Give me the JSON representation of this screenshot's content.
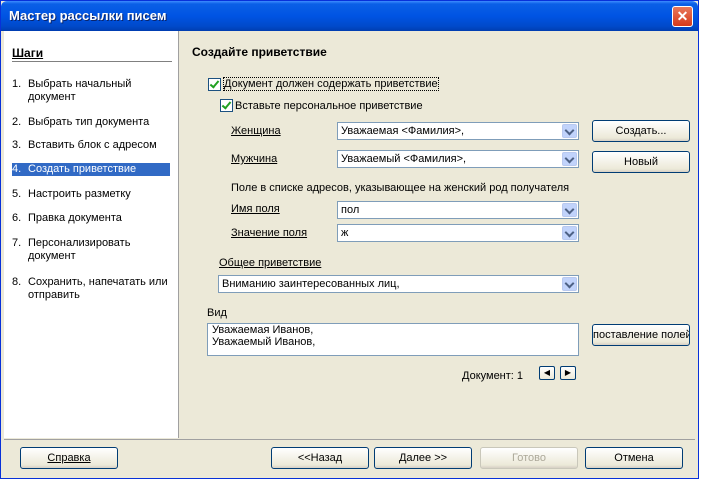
{
  "window": {
    "title": "Мастер рассылки писем",
    "close_glyph": "✕"
  },
  "sidebar": {
    "title": "Шаги",
    "steps": [
      {
        "num": "1.",
        "label": "Выбрать начальный документ"
      },
      {
        "num": "2.",
        "label": "Выбрать тип документа"
      },
      {
        "num": "3.",
        "label": "Вставить блок с адресом"
      },
      {
        "num": "4.",
        "label": "Создать приветствие"
      },
      {
        "num": "5.",
        "label": "Настроить разметку"
      },
      {
        "num": "6.",
        "label": "Правка документа"
      },
      {
        "num": "7.",
        "label": "Персонализировать документ"
      },
      {
        "num": "8.",
        "label": "Сохранить, напечатать или отправить"
      }
    ],
    "active_step": 4
  },
  "main": {
    "title": "Создайте приветствие",
    "contain_greeting": {
      "label": "Документ должен содержать приветствие",
      "checked": true
    },
    "personal_greeting": {
      "label": "Вставьте персональное приветствие",
      "checked": true
    },
    "female": {
      "label": "Женщина",
      "value": "Уважаемая <Фамилия>,"
    },
    "male": {
      "label": "Мужчина",
      "value": "Уважаемый <Фамилия>,"
    },
    "buttons": {
      "create": "Создать...",
      "new": "Новый",
      "field_mapping": "поставление полей"
    },
    "field_section_label": "Поле в списке адресов, указывающее на женский род получателя",
    "field_name": {
      "label": "Имя поля",
      "value": "пол"
    },
    "field_value": {
      "label": "Значение поля",
      "value": "ж"
    },
    "general": {
      "label": "Общее приветствие",
      "value": "Вниманию заинтересованных лиц,"
    },
    "preview": {
      "label": "Вид",
      "lines": [
        "Уважаемая Иванов,",
        "Уважаемый Иванов,"
      ]
    },
    "document_label": "Документ: 1",
    "prev_glyph": "◀",
    "next_glyph": "▶"
  },
  "footer": {
    "help": "Справка",
    "back": "<<Назад",
    "next": "Далее >>",
    "finish": "Готово",
    "cancel": "Отмена"
  }
}
